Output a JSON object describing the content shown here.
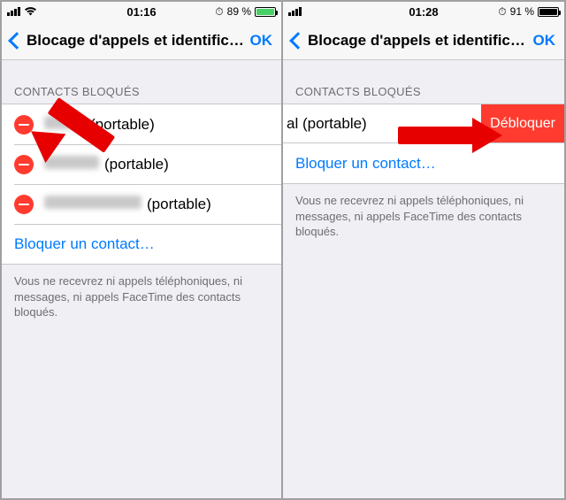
{
  "left": {
    "status": {
      "time": "01:16",
      "battery_text": "89 %",
      "battery_level": 0.89,
      "battery_color": "green"
    },
    "nav": {
      "title": "Blocage d'appels et identific…",
      "ok": "OK"
    },
    "section_label": "CONTACTS BLOQUÉS",
    "contacts": [
      {
        "suffix": "(portable)",
        "blur_width": 46
      },
      {
        "suffix": "(portable)",
        "blur_width": 62
      },
      {
        "suffix": "(portable)",
        "blur_width": 110
      }
    ],
    "add_label": "Bloquer un contact…",
    "footnote": "Vous ne recevrez ni appels téléphoniques, ni messages, ni appels FaceTime des contacts bloqués."
  },
  "right": {
    "status": {
      "time": "01:28",
      "battery_text": "91 %",
      "battery_level": 0.91,
      "battery_color": "black"
    },
    "nav": {
      "title": "Blocage d'appels et identific…",
      "ok": "OK"
    },
    "section_label": "CONTACTS BLOQUÉS",
    "swipe": {
      "visible_text": "al (portable)",
      "action": "Débloquer"
    },
    "add_label": "Bloquer un contact…",
    "footnote": "Vous ne recevrez ni appels téléphoniques, ni messages, ni appels FaceTime des contacts bloqués."
  }
}
